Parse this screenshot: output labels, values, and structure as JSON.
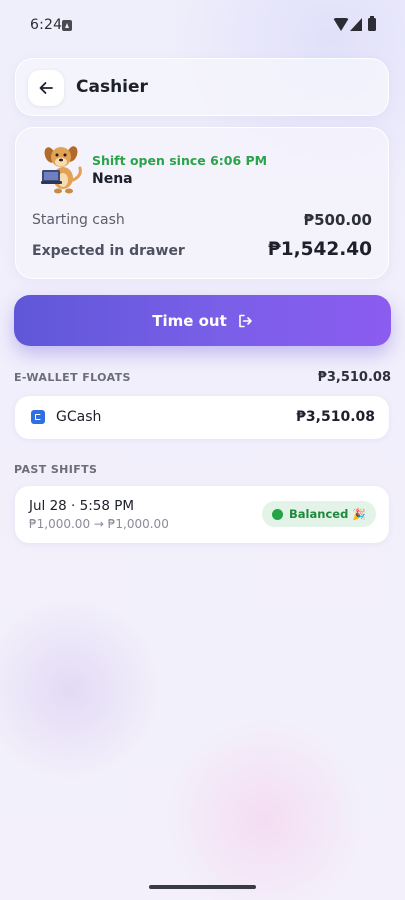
{
  "status_bar": {
    "time": "6:24",
    "icons": [
      "notification-icon",
      "wifi-icon",
      "signal-icon",
      "battery-icon"
    ]
  },
  "header": {
    "title": "Cashier",
    "back_icon": "arrow-left-icon"
  },
  "shift": {
    "status": "Shift open since 6:06 PM",
    "cashier_name": "Nena",
    "starting_cash_label": "Starting cash",
    "starting_cash_value": "₱500.00",
    "expected_label": "Expected in drawer",
    "expected_value": "₱1,542.40"
  },
  "time_out": {
    "label": "Time out",
    "icon": "logout-icon"
  },
  "ewallet": {
    "header": "E-WALLET FLOATS",
    "total": "₱3,510.08",
    "items": [
      {
        "name": "GCash",
        "amount": "₱3,510.08",
        "icon": "gcash-icon"
      }
    ]
  },
  "past_shifts": {
    "header": "PAST SHIFTS",
    "items": [
      {
        "date": "Jul 28 · 5:58 PM",
        "range": "₱1,000.00 → ₱1,000.00",
        "badge": "Balanced",
        "badge_emoji": "🎉"
      }
    ]
  },
  "colors": {
    "accent_start": "#5f57d8",
    "accent_end": "#8b5cf0",
    "success": "#2aa34a",
    "badge_bg": "#e3f3e7"
  }
}
